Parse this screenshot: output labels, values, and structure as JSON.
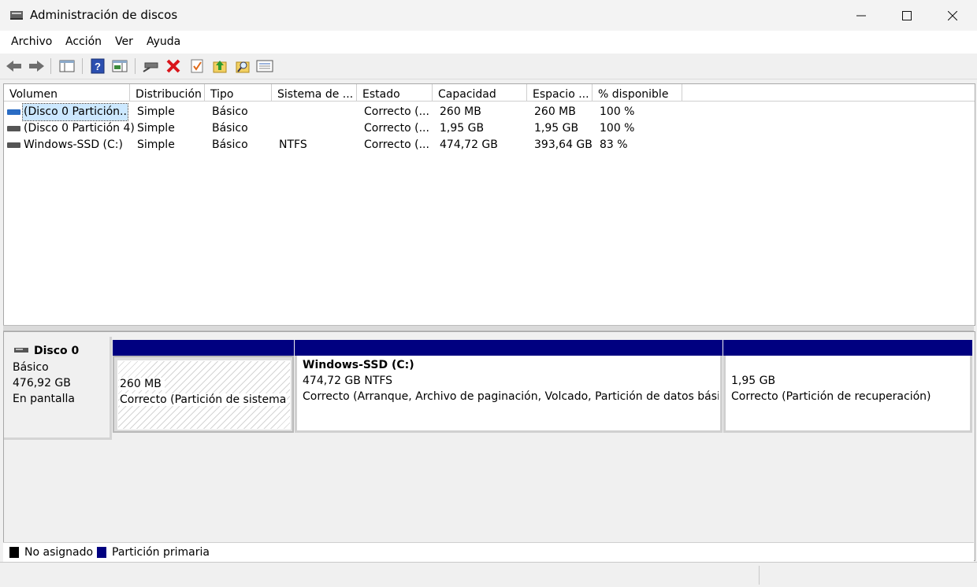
{
  "window": {
    "title": "Administración de discos",
    "icon": "disk-management-icon"
  },
  "menu": [
    "Archivo",
    "Acción",
    "Ver",
    "Ayuda"
  ],
  "toolbar_icons": [
    "back-arrow-icon",
    "forward-arrow-icon",
    "show-hide-console-tree-icon",
    "help-icon",
    "properties-view-icon",
    "connect-drive-icon",
    "delete-icon",
    "check-properties-icon",
    "up-level-icon",
    "search-icon",
    "list-view-icon"
  ],
  "columns": [
    "Volumen",
    "Distribución",
    "Tipo",
    "Sistema de ...",
    "Estado",
    "Capacidad",
    "Espacio ...",
    "% disponible"
  ],
  "volumes": [
    {
      "name": "(Disco 0 Partición...",
      "layout": "Simple",
      "type": "Básico",
      "fs": "",
      "status": "Correcto (...",
      "capacity": "260 MB",
      "free": "260 MB",
      "pct": "100 %",
      "selected": true
    },
    {
      "name": "(Disco 0 Partición 4)",
      "layout": "Simple",
      "type": "Básico",
      "fs": "",
      "status": "Correcto (...",
      "capacity": "1,95 GB",
      "free": "1,95 GB",
      "pct": "100 %",
      "selected": false
    },
    {
      "name": "Windows-SSD (C:)",
      "layout": "Simple",
      "type": "Básico",
      "fs": "NTFS",
      "status": "Correcto (...",
      "capacity": "474,72 GB",
      "free": "393,64 GB",
      "pct": "83 %",
      "selected": false
    }
  ],
  "disk": {
    "name": "Disco 0",
    "type": "Básico",
    "size": "476,92 GB",
    "state": "En pantalla"
  },
  "partitions": [
    {
      "title": "",
      "size": "260 MB",
      "status": "Correcto (Partición de sistema E",
      "hatched": true
    },
    {
      "title": "Windows-SSD  (C:)",
      "size": "474,72 GB NTFS",
      "status": "Correcto (Arranque, Archivo de paginación, Volcado, Partición de datos básicos",
      "hatched": false
    },
    {
      "title": "",
      "size": "1,95 GB",
      "status": "Correcto (Partición de recuperación)",
      "hatched": false
    }
  ],
  "legend": [
    {
      "label": "No asignado",
      "color": "#000000"
    },
    {
      "label": "Partición primaria",
      "color": "#000080"
    }
  ],
  "colors": {
    "partition_header": "#000080",
    "selection": "#cce8ff"
  }
}
